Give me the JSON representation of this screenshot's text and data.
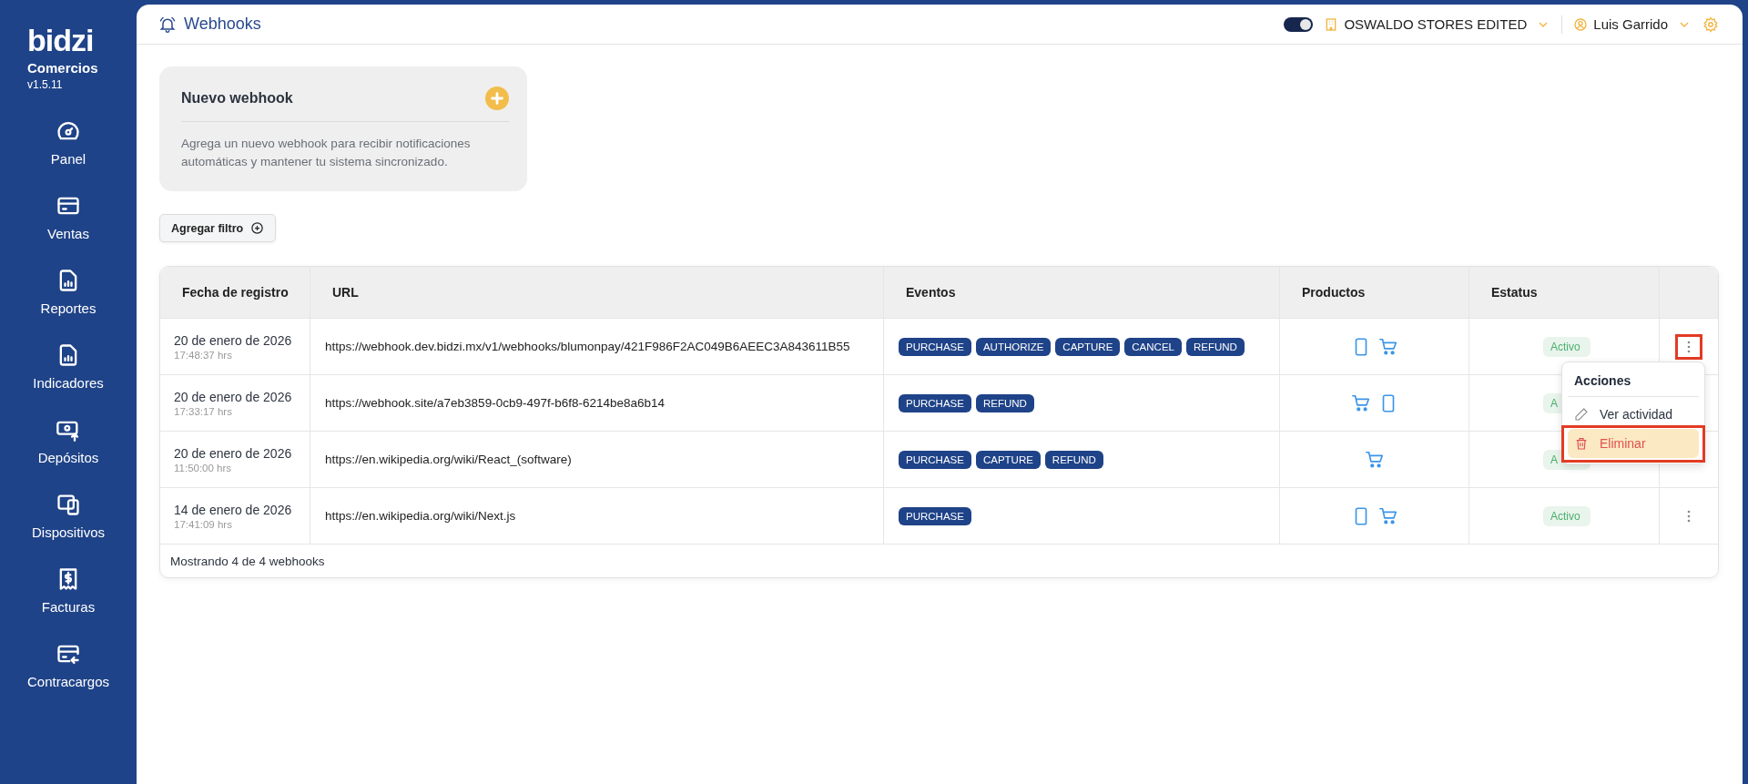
{
  "sidebar": {
    "logo": "bidzi",
    "product": "Comercios",
    "version": "v1.5.11",
    "items": [
      {
        "label": "Panel"
      },
      {
        "label": "Ventas"
      },
      {
        "label": "Reportes"
      },
      {
        "label": "Indicadores"
      },
      {
        "label": "Depósitos"
      },
      {
        "label": "Dispositivos"
      },
      {
        "label": "Facturas"
      },
      {
        "label": "Contracargos"
      }
    ]
  },
  "header": {
    "title": "Webhooks",
    "theme_toggle": {
      "on": true
    },
    "store": "OSWALDO STORES EDITED",
    "user": "Luis Garrido"
  },
  "new_webhook_card": {
    "title": "Nuevo webhook",
    "description": "Agrega un nuevo webhook para recibir notificaciones automáticas y mantener tu sistema sincronizado."
  },
  "filter_button": "Agregar filtro",
  "table": {
    "columns": [
      "Fecha de registro",
      "URL",
      "Eventos",
      "Productos",
      "Estatus"
    ],
    "rows": [
      {
        "date": "20 de enero de 2026",
        "time": "17:48:37 hrs",
        "url": "https://webhook.dev.bidzi.mx/v1/webhooks/blumonpay/421F986F2AC049B6AEEC3A843611B55",
        "events": [
          "PURCHASE",
          "AUTHORIZE",
          "CAPTURE",
          "CANCEL",
          "REFUND"
        ],
        "products": [
          {
            "kind": "device"
          },
          {
            "kind": "cart"
          }
        ],
        "status": "Activo",
        "menu_button": true
      },
      {
        "date": "20 de enero de 2026",
        "time": "17:33:17 hrs",
        "url": "https://webhook.site/a7eb3859-0cb9-497f-b6f8-6214be8a6b14",
        "events": [
          "PURCHASE",
          "REFUND"
        ],
        "products": [
          {
            "kind": "cart"
          },
          {
            "kind": "device"
          }
        ],
        "status": "A",
        "menu_button": false
      },
      {
        "date": "20 de enero de 2026",
        "time": "11:50:00 hrs",
        "url": "https://en.wikipedia.org/wiki/React_(software)",
        "events": [
          "PURCHASE",
          "CAPTURE",
          "REFUND"
        ],
        "products": [
          {
            "kind": "cart"
          }
        ],
        "status": "A",
        "menu_button": false
      },
      {
        "date": "14 de enero de 2026",
        "time": "17:41:09 hrs",
        "url": "https://en.wikipedia.org/wiki/Next.js",
        "events": [
          "PURCHASE"
        ],
        "products": [
          {
            "kind": "device"
          },
          {
            "kind": "cart"
          }
        ],
        "status": "Activo",
        "menu_button": true
      }
    ],
    "footer": "Mostrando 4 de 4 webhooks"
  },
  "actions_menu": {
    "title": "Acciones",
    "trigger_highlighted": true,
    "items": [
      {
        "label": "Ver actividad",
        "kind": "edit",
        "selected": false,
        "highlighted": false
      },
      {
        "label": "Eliminar",
        "kind": "delete",
        "selected": true,
        "highlighted": true
      }
    ]
  }
}
